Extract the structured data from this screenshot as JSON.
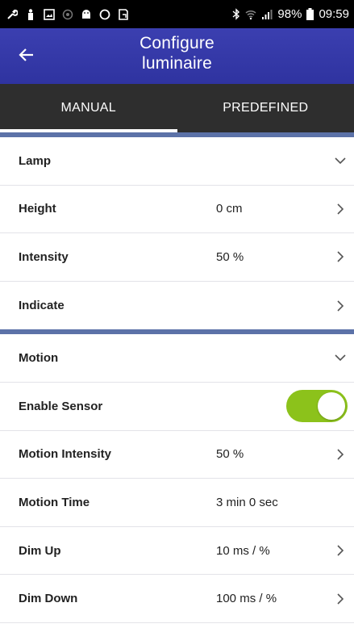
{
  "status_bar": {
    "battery": "98%",
    "time": "09:59",
    "icons": [
      "wrench-icon",
      "person-icon",
      "image-icon",
      "circle-dot-icon",
      "android-icon",
      "ring-icon",
      "screenshot-icon",
      "bluetooth-icon",
      "wifi-icon",
      "signal-icon",
      "battery-icon"
    ]
  },
  "app_bar": {
    "title": "Configure luminaire",
    "back_icon": "arrow-left-icon"
  },
  "tabs": [
    {
      "label": "MANUAL",
      "active": true
    },
    {
      "label": "PREDEFINED",
      "active": false
    }
  ],
  "lamp_section": {
    "header": "Lamp",
    "rows": [
      {
        "label": "Height",
        "value": "0 cm"
      },
      {
        "label": "Intensity",
        "value": "50 %"
      },
      {
        "label": "Indicate",
        "value": ""
      }
    ]
  },
  "motion_section": {
    "header": "Motion",
    "enable_sensor": {
      "label": "Enable Sensor",
      "on": true
    },
    "rows": [
      {
        "label": "Motion Intensity",
        "value": "50 %"
      },
      {
        "label": "Motion Time",
        "value": "3 min 0 sec"
      },
      {
        "label": "Dim Up",
        "value": "10 ms / %"
      },
      {
        "label": "Dim Down",
        "value": "100 ms / %"
      }
    ]
  },
  "colors": {
    "app_bar": "#3b3fb0",
    "tabs_bg": "#2e2e2e",
    "separator": "#5c72a8",
    "toggle_on": "#8cc21b"
  }
}
